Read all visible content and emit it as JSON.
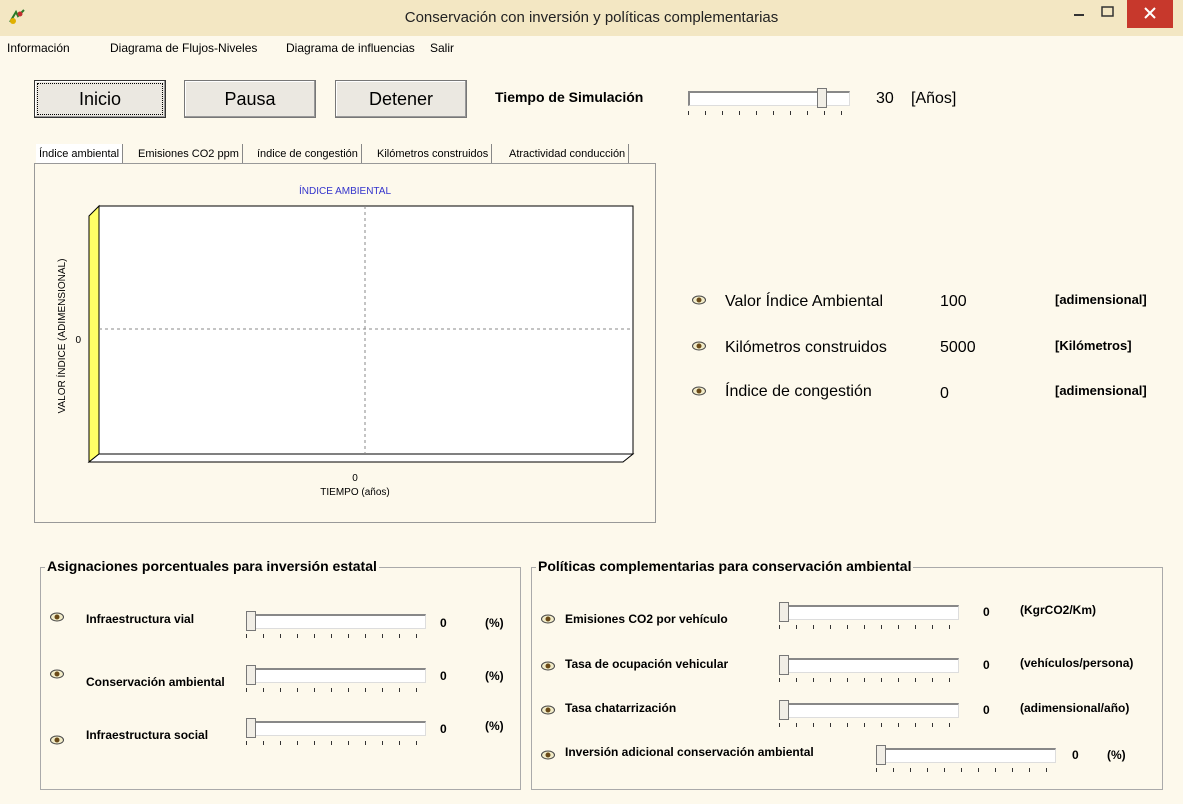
{
  "window": {
    "title": "Conservación con inversión y políticas complementarias"
  },
  "menu": [
    "Información",
    "Diagrama de Flujos-Niveles",
    "Diagrama de influencias",
    "Salir"
  ],
  "controls": {
    "start": "Inicio",
    "pause": "Pausa",
    "stop": "Detener",
    "sim_time_label": "Tiempo de Simulación",
    "sim_time_value": "30",
    "sim_time_unit": "[Años]",
    "sim_time_fraction": 0.85
  },
  "tabs": [
    "Índice ambiental",
    "Emisiones CO2 ppm",
    "índice de congestión",
    "Kilómetros construidos",
    "Atractividad conducción"
  ],
  "chart_data": {
    "type": "line",
    "title": "ÍNDICE AMBIENTAL",
    "xlabel": "TIEMPO (años)",
    "ylabel": "VALOR ÍNDICE (ADIMENSIONAL)",
    "x_ticks": [
      "0"
    ],
    "y_ticks": [
      "0"
    ],
    "series": [],
    "grid": true
  },
  "indicators": [
    {
      "label": "Valor Índice Ambiental",
      "value": "100",
      "unit": "[adimensional]"
    },
    {
      "label": "Kilómetros construidos",
      "value": "5000",
      "unit": "[Kilómetros]"
    },
    {
      "label": "Índice de congestión",
      "value": "0",
      "unit": "[adimensional]"
    }
  ],
  "investment": {
    "title": "Asignaciones porcentuales para inversión estatal",
    "items": [
      {
        "label": "Infraestructura vial",
        "value": "0",
        "unit": "(%)"
      },
      {
        "label": "Conservación ambiental",
        "value": "0",
        "unit": "(%)"
      },
      {
        "label": "Infraestructura social",
        "value": "0",
        "unit": "(%)"
      }
    ]
  },
  "policies": {
    "title": "Políticas complementarias para conservación ambiental",
    "items": [
      {
        "label": "Emisiones CO2 por vehículo",
        "value": "0",
        "unit": "(KgrCO2/Km)"
      },
      {
        "label": "Tasa de ocupación vehicular",
        "value": "0",
        "unit": "(vehículos/persona)"
      },
      {
        "label": "Tasa chatarrización",
        "value": "0",
        "unit": "(adimensional/año)"
      },
      {
        "label": "Inversión adicional conservación ambiental",
        "value": "0",
        "unit": "(%)"
      }
    ]
  },
  "colors": {
    "background": "#fdf9ec",
    "title_bar": "#f3e7c3",
    "close": "#c7382c",
    "chart_title": "#3333cc",
    "wall": "#ffff66"
  }
}
